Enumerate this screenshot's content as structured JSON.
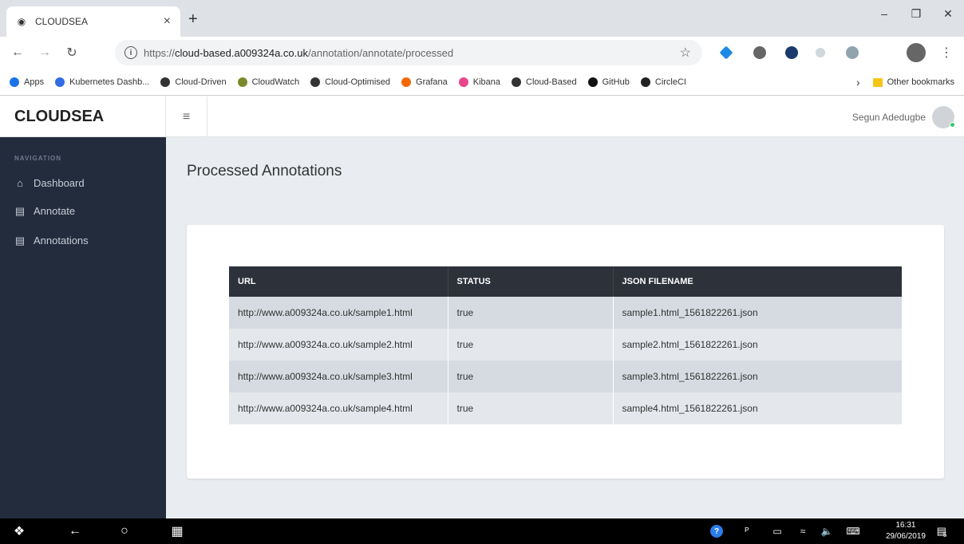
{
  "browser": {
    "tab_title": "CLOUDSEA",
    "url_prefix": "https://",
    "url_host": "cloud-based.a009324a.co.uk",
    "url_path": "/annotation/annotate/processed",
    "bookmarks": [
      {
        "label": "Apps",
        "icon": "apps-grid-icon",
        "color": "#1a73e8"
      },
      {
        "label": "Kubernetes Dashb...",
        "icon": "kubernetes-icon",
        "color": "#326ce5"
      },
      {
        "label": "Cloud-Driven",
        "icon": "cloud-driven-icon",
        "color": "#333333"
      },
      {
        "label": "CloudWatch",
        "icon": "cloudwatch-icon",
        "color": "#7a8a2a"
      },
      {
        "label": "Cloud-Optimised",
        "icon": "cloud-optimised-icon",
        "color": "#333333"
      },
      {
        "label": "Grafana",
        "icon": "grafana-icon",
        "color": "#f46800"
      },
      {
        "label": "Kibana",
        "icon": "kibana-icon",
        "color": "#e8478b"
      },
      {
        "label": "Cloud-Based",
        "icon": "cloud-based-icon",
        "color": "#333333"
      },
      {
        "label": "GitHub",
        "icon": "github-icon",
        "color": "#111111"
      },
      {
        "label": "CircleCI",
        "icon": "circleci-icon",
        "color": "#222222"
      }
    ],
    "other_bookmarks": "Other bookmarks"
  },
  "app": {
    "brand": "CLOUDSEA",
    "user_name": "Segun Adedugbe",
    "nav_heading": "NAVIGATION",
    "nav_items": [
      {
        "label": "Dashboard",
        "icon": "home-icon"
      },
      {
        "label": "Annotate",
        "icon": "document-icon"
      },
      {
        "label": "Annotations",
        "icon": "document-icon"
      }
    ],
    "page_title": "Processed Annotations",
    "table": {
      "headers": [
        "URL",
        "STATUS",
        "JSON FILENAME"
      ],
      "rows": [
        [
          "http://www.a009324a.co.uk/sample1.html",
          "true",
          "sample1.html_1561822261.json"
        ],
        [
          "http://www.a009324a.co.uk/sample2.html",
          "true",
          "sample2.html_1561822261.json"
        ],
        [
          "http://www.a009324a.co.uk/sample3.html",
          "true",
          "sample3.html_1561822261.json"
        ],
        [
          "http://www.a009324a.co.uk/sample4.html",
          "true",
          "sample4.html_1561822261.json"
        ]
      ]
    }
  },
  "taskbar": {
    "time": "16:31",
    "date": "29/06/2019",
    "notification_count": "5"
  },
  "colors": {
    "sidebar_bg": "#222c3c",
    "table_header_bg": "#2d3139",
    "main_bg": "#e9edf1"
  }
}
